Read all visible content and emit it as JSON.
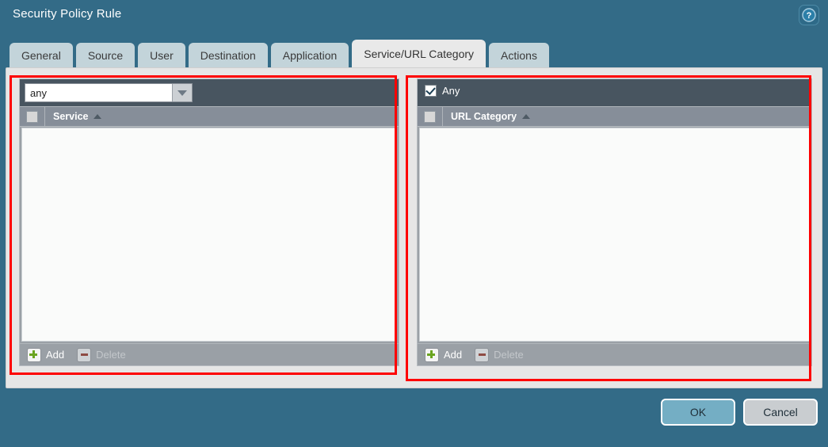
{
  "dialog": {
    "title": "Security Policy Rule",
    "help_icon": "help-question-icon"
  },
  "tabs": [
    {
      "label": "General",
      "active": false
    },
    {
      "label": "Source",
      "active": false
    },
    {
      "label": "User",
      "active": false
    },
    {
      "label": "Destination",
      "active": false
    },
    {
      "label": "Application",
      "active": false
    },
    {
      "label": "Service/URL Category",
      "active": true
    },
    {
      "label": "Actions",
      "active": false
    }
  ],
  "service_panel": {
    "dropdown": {
      "value": "any",
      "placeholder": "any",
      "arrow_icon": "chevron-down-icon"
    },
    "column_header": {
      "label": "Service",
      "sort_icon": "sort-ascending-icon",
      "select_all_checked": false
    },
    "rows": [],
    "footer": {
      "add_label": "Add",
      "add_icon": "plus-icon",
      "delete_label": "Delete",
      "delete_icon": "minus-icon",
      "delete_disabled": true
    }
  },
  "url_category_panel": {
    "any": {
      "label": "Any",
      "checked": true
    },
    "column_header": {
      "label": "URL Category",
      "sort_icon": "sort-ascending-icon",
      "select_all_checked": false
    },
    "rows": [],
    "footer": {
      "add_label": "Add",
      "add_icon": "plus-icon",
      "delete_label": "Delete",
      "delete_icon": "minus-icon",
      "delete_disabled": true
    }
  },
  "footer": {
    "ok_label": "OK",
    "cancel_label": "Cancel"
  },
  "annotations": {
    "color": "#fe0000",
    "count": 2
  },
  "colors": {
    "dialog_background": "#336b87",
    "content_background": "#e6e6e6",
    "tab_inactive": "#c3d4da",
    "tab_active": "#e9e9e9",
    "panel_topbar": "#485560",
    "panel_header": "#868e99",
    "panel_toolbar": "#9aa0a6",
    "list_body": "#fafbfa",
    "ok_button": "#74aec4",
    "cancel_button": "#c9cdd0",
    "annotation": "#fe0000"
  }
}
